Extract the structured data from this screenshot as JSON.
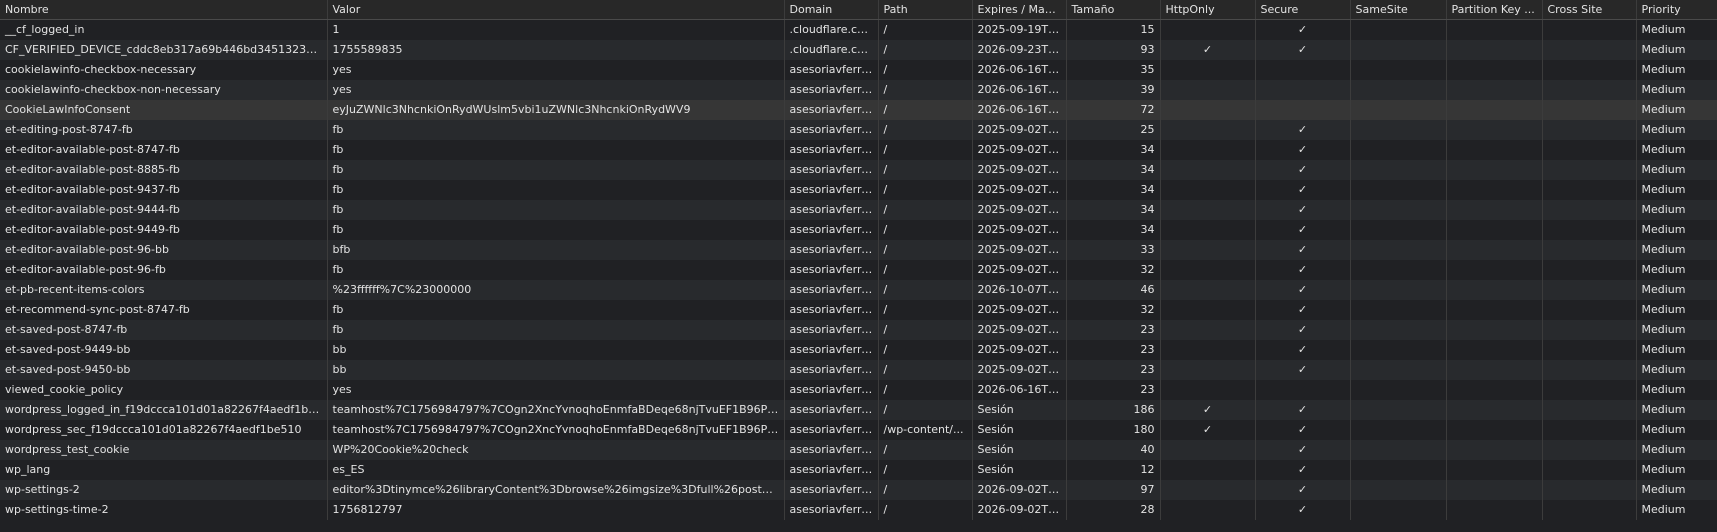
{
  "columns": [
    {
      "key": "name",
      "label": "Nombre"
    },
    {
      "key": "value",
      "label": "Valor"
    },
    {
      "key": "domain",
      "label": "Domain"
    },
    {
      "key": "path",
      "label": "Path"
    },
    {
      "key": "expires",
      "label": "Expires / Max-..."
    },
    {
      "key": "size",
      "label": "Tamaño"
    },
    {
      "key": "httponly",
      "label": "HttpOnly"
    },
    {
      "key": "secure",
      "label": "Secure"
    },
    {
      "key": "samesite",
      "label": "SameSite"
    },
    {
      "key": "partition",
      "label": "Partition Key ..."
    },
    {
      "key": "crosssite",
      "label": "Cross Site"
    },
    {
      "key": "priority",
      "label": "Priority"
    }
  ],
  "rows": [
    {
      "name": "__cf_logged_in",
      "value": "1",
      "domain": ".cloudflare.com",
      "path": "/",
      "expires": "2025-09-19T0...",
      "size": "15",
      "httponly": "",
      "secure": "✓",
      "samesite": "",
      "partition": "",
      "crosssite": "",
      "priority": "Medium"
    },
    {
      "name": "CF_VERIFIED_DEVICE_cddc8eb317a69b446bd3451323301...",
      "value": "1755589835",
      "domain": ".cloudflare.com",
      "path": "/",
      "expires": "2026-09-23T0...",
      "size": "93",
      "httponly": "✓",
      "secure": "✓",
      "samesite": "",
      "partition": "",
      "crosssite": "",
      "priority": "Medium"
    },
    {
      "name": "cookielawinfo-checkbox-necessary",
      "value": "yes",
      "domain": "asesoriavferre...",
      "path": "/",
      "expires": "2026-06-16T0...",
      "size": "35",
      "httponly": "",
      "secure": "",
      "samesite": "",
      "partition": "",
      "crosssite": "",
      "priority": "Medium"
    },
    {
      "name": "cookielawinfo-checkbox-non-necessary",
      "value": "yes",
      "domain": "asesoriavferre...",
      "path": "/",
      "expires": "2026-06-16T0...",
      "size": "39",
      "httponly": "",
      "secure": "",
      "samesite": "",
      "partition": "",
      "crosssite": "",
      "priority": "Medium"
    },
    {
      "name": "CookieLawInfoConsent",
      "value": "eyJuZWNlc3NhcnkiOnRydWUslm5vbi1uZWNlc3NhcnkiOnRydWV9",
      "domain": "asesoriavferre...",
      "path": "/",
      "expires": "2026-06-16T0...",
      "size": "72",
      "httponly": "",
      "secure": "",
      "samesite": "",
      "partition": "",
      "crosssite": "",
      "priority": "Medium"
    },
    {
      "name": "et-editing-post-8747-fb",
      "value": "fb",
      "domain": "asesoriavferre...",
      "path": "/",
      "expires": "2025-09-02T1...",
      "size": "25",
      "httponly": "",
      "secure": "✓",
      "samesite": "",
      "partition": "",
      "crosssite": "",
      "priority": "Medium"
    },
    {
      "name": "et-editor-available-post-8747-fb",
      "value": "fb",
      "domain": "asesoriavferre...",
      "path": "/",
      "expires": "2025-09-02T1...",
      "size": "34",
      "httponly": "",
      "secure": "✓",
      "samesite": "",
      "partition": "",
      "crosssite": "",
      "priority": "Medium"
    },
    {
      "name": "et-editor-available-post-8885-fb",
      "value": "fb",
      "domain": "asesoriavferre...",
      "path": "/",
      "expires": "2025-09-02T1...",
      "size": "34",
      "httponly": "",
      "secure": "✓",
      "samesite": "",
      "partition": "",
      "crosssite": "",
      "priority": "Medium"
    },
    {
      "name": "et-editor-available-post-9437-fb",
      "value": "fb",
      "domain": "asesoriavferre...",
      "path": "/",
      "expires": "2025-09-02T1...",
      "size": "34",
      "httponly": "",
      "secure": "✓",
      "samesite": "",
      "partition": "",
      "crosssite": "",
      "priority": "Medium"
    },
    {
      "name": "et-editor-available-post-9444-fb",
      "value": "fb",
      "domain": "asesoriavferre...",
      "path": "/",
      "expires": "2025-09-02T1...",
      "size": "34",
      "httponly": "",
      "secure": "✓",
      "samesite": "",
      "partition": "",
      "crosssite": "",
      "priority": "Medium"
    },
    {
      "name": "et-editor-available-post-9449-fb",
      "value": "fb",
      "domain": "asesoriavferre...",
      "path": "/",
      "expires": "2025-09-02T1...",
      "size": "34",
      "httponly": "",
      "secure": "✓",
      "samesite": "",
      "partition": "",
      "crosssite": "",
      "priority": "Medium"
    },
    {
      "name": "et-editor-available-post-96-bb",
      "value": "bfb",
      "domain": "asesoriavferre...",
      "path": "/",
      "expires": "2025-09-02T1...",
      "size": "33",
      "httponly": "",
      "secure": "✓",
      "samesite": "",
      "partition": "",
      "crosssite": "",
      "priority": "Medium"
    },
    {
      "name": "et-editor-available-post-96-fb",
      "value": "fb",
      "domain": "asesoriavferre...",
      "path": "/",
      "expires": "2025-09-02T1...",
      "size": "32",
      "httponly": "",
      "secure": "✓",
      "samesite": "",
      "partition": "",
      "crosssite": "",
      "priority": "Medium"
    },
    {
      "name": "et-pb-recent-items-colors",
      "value": "%23ffffff%7C%23000000",
      "domain": "asesoriavferre...",
      "path": "/",
      "expires": "2026-10-07T1...",
      "size": "46",
      "httponly": "",
      "secure": "✓",
      "samesite": "",
      "partition": "",
      "crosssite": "",
      "priority": "Medium"
    },
    {
      "name": "et-recommend-sync-post-8747-fb",
      "value": "fb",
      "domain": "asesoriavferre...",
      "path": "/",
      "expires": "2025-09-02T1...",
      "size": "32",
      "httponly": "",
      "secure": "✓",
      "samesite": "",
      "partition": "",
      "crosssite": "",
      "priority": "Medium"
    },
    {
      "name": "et-saved-post-8747-fb",
      "value": "fb",
      "domain": "asesoriavferre...",
      "path": "/",
      "expires": "2025-09-02T1...",
      "size": "23",
      "httponly": "",
      "secure": "✓",
      "samesite": "",
      "partition": "",
      "crosssite": "",
      "priority": "Medium"
    },
    {
      "name": "et-saved-post-9449-bb",
      "value": "bb",
      "domain": "asesoriavferre...",
      "path": "/",
      "expires": "2025-09-02T1...",
      "size": "23",
      "httponly": "",
      "secure": "✓",
      "samesite": "",
      "partition": "",
      "crosssite": "",
      "priority": "Medium"
    },
    {
      "name": "et-saved-post-9450-bb",
      "value": "bb",
      "domain": "asesoriavferre...",
      "path": "/",
      "expires": "2025-09-02T1...",
      "size": "23",
      "httponly": "",
      "secure": "✓",
      "samesite": "",
      "partition": "",
      "crosssite": "",
      "priority": "Medium"
    },
    {
      "name": "viewed_cookie_policy",
      "value": "yes",
      "domain": "asesoriavferre...",
      "path": "/",
      "expires": "2026-06-16T0...",
      "size": "23",
      "httponly": "",
      "secure": "",
      "samesite": "",
      "partition": "",
      "crosssite": "",
      "priority": "Medium"
    },
    {
      "name": "wordpress_logged_in_f19dccca101d01a82267f4aedf1be5...",
      "value": "teamhost%7C1756984797%7COgn2XncYvnoqhoEnmfaBDeqe68njTvuEF1B96PI2ow...",
      "domain": "asesoriavferre...",
      "path": "/",
      "expires": "Sesión",
      "size": "186",
      "httponly": "✓",
      "secure": "✓",
      "samesite": "",
      "partition": "",
      "crosssite": "",
      "priority": "Medium"
    },
    {
      "name": "wordpress_sec_f19dccca101d01a82267f4aedf1be510",
      "value": "teamhost%7C1756984797%7COgn2XncYvnoqhoEnmfaBDeqe68njTvuEF1B96PI2ow...",
      "domain": "asesoriavferre...",
      "path": "/wp-content/...",
      "expires": "Sesión",
      "size": "180",
      "httponly": "✓",
      "secure": "✓",
      "samesite": "",
      "partition": "",
      "crosssite": "",
      "priority": "Medium"
    },
    {
      "name": "wordpress_test_cookie",
      "value": "WP%20Cookie%20check",
      "domain": "asesoriavferre...",
      "path": "/",
      "expires": "Sesión",
      "size": "40",
      "httponly": "",
      "secure": "✓",
      "samesite": "",
      "partition": "",
      "crosssite": "",
      "priority": "Medium"
    },
    {
      "name": "wp_lang",
      "value": "es_ES",
      "domain": "asesoriavferre...",
      "path": "/",
      "expires": "Sesión",
      "size": "12",
      "httponly": "",
      "secure": "✓",
      "samesite": "",
      "partition": "",
      "crosssite": "",
      "priority": "Medium"
    },
    {
      "name": "wp-settings-2",
      "value": "editor%3Dtinymce%26libraryContent%3Dbrowse%26imgsize%3Dfull%26posts_list_...",
      "domain": "asesoriavferre...",
      "path": "/",
      "expires": "2026-09-02T1...",
      "size": "97",
      "httponly": "",
      "secure": "✓",
      "samesite": "",
      "partition": "",
      "crosssite": "",
      "priority": "Medium"
    },
    {
      "name": "wp-settings-time-2",
      "value": "1756812797",
      "domain": "asesoriavferre...",
      "path": "/",
      "expires": "2026-09-02T1...",
      "size": "28",
      "httponly": "",
      "secure": "✓",
      "samesite": "",
      "partition": "",
      "crosssite": "",
      "priority": "Medium"
    }
  ],
  "selected_row": 4
}
